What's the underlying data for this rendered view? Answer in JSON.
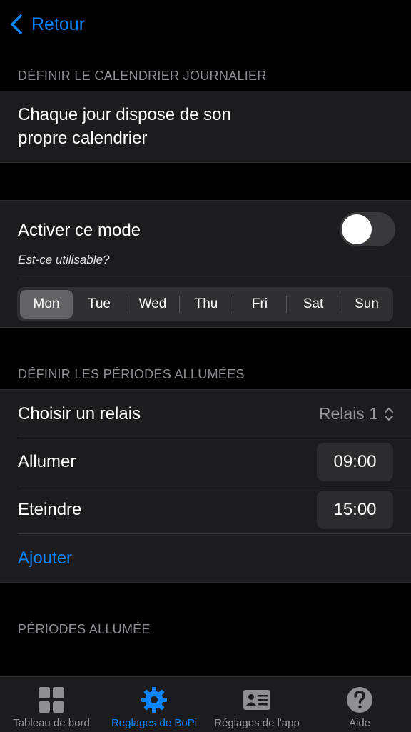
{
  "nav": {
    "back_label": "Retour"
  },
  "daily": {
    "header": "DÉFINIR LE CALENDRIER JOURNALIER",
    "description": "Chaque jour dispose de son propre calendrier"
  },
  "mode": {
    "label": "Activer ce mode",
    "subtitle": "Est-ce utilisable?",
    "toggle_on": false,
    "days": [
      "Mon",
      "Tue",
      "Wed",
      "Thu",
      "Fri",
      "Sat",
      "Sun"
    ],
    "selected_day": "Mon"
  },
  "periods": {
    "header": "DÉFINIR LES PÉRIODES ALLUMÉES",
    "relay_label": "Choisir un relais",
    "relay_value": "Relais 1",
    "on_label": "Allumer",
    "on_time": "09:00",
    "off_label": "Eteindre",
    "off_time": "15:00",
    "add_label": "Ajouter"
  },
  "periods_list": {
    "header": "PÉRIODES ALLUMÉE"
  },
  "tabbar": {
    "items": [
      {
        "label": "Tableau de bord",
        "icon": "grid-icon"
      },
      {
        "label": "Reglages de BoPi",
        "icon": "gear-icon"
      },
      {
        "label": "Réglages de l'app",
        "icon": "contact-card-icon"
      },
      {
        "label": "Aide",
        "icon": "question-circle-icon"
      }
    ],
    "active_index": 1,
    "accent_color": "#0a84ff"
  }
}
